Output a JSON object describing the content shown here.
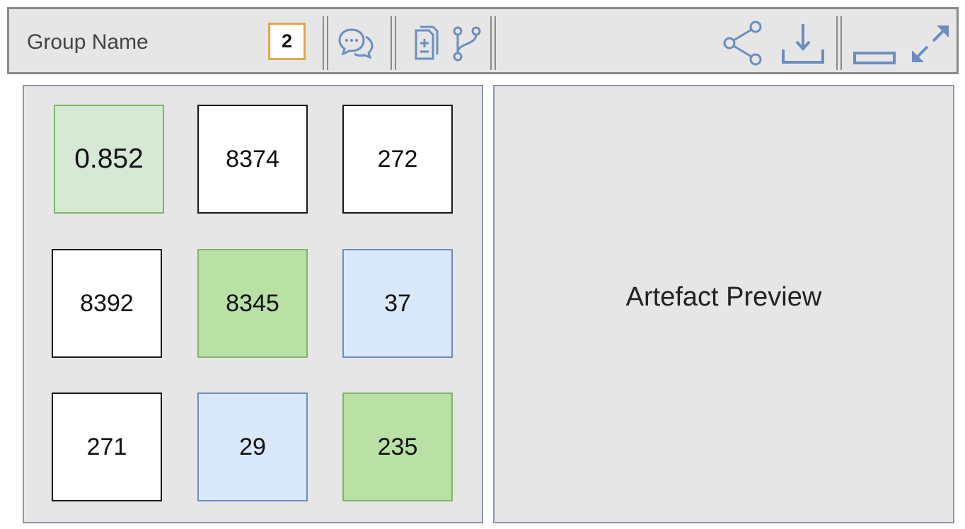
{
  "toolbar": {
    "group_name": "Group Name",
    "count_badge": "2",
    "icons": [
      "comment-icon",
      "add-document-icon",
      "branch-icon",
      "share-icon",
      "download-icon",
      "minimize-icon",
      "expand-icon"
    ],
    "icon_color": "#6c8ebf",
    "badge_border_color": "#e0a84a"
  },
  "grid": {
    "tiles": [
      {
        "value": "0.852",
        "color": "lightgreen"
      },
      {
        "value": "8374",
        "color": "white"
      },
      {
        "value": "272",
        "color": "white"
      },
      {
        "value": "8392",
        "color": "white"
      },
      {
        "value": "8345",
        "color": "green"
      },
      {
        "value": "37",
        "color": "blue"
      },
      {
        "value": "271",
        "color": "white"
      },
      {
        "value": "29",
        "color": "blue"
      },
      {
        "value": "235",
        "color": "green"
      }
    ]
  },
  "preview": {
    "label": "Artefact Preview"
  },
  "colors": {
    "lightgreen": "#d6e9d5",
    "green": "#b9e0a5",
    "blue": "#dae8fc",
    "white": "#ffffff"
  }
}
